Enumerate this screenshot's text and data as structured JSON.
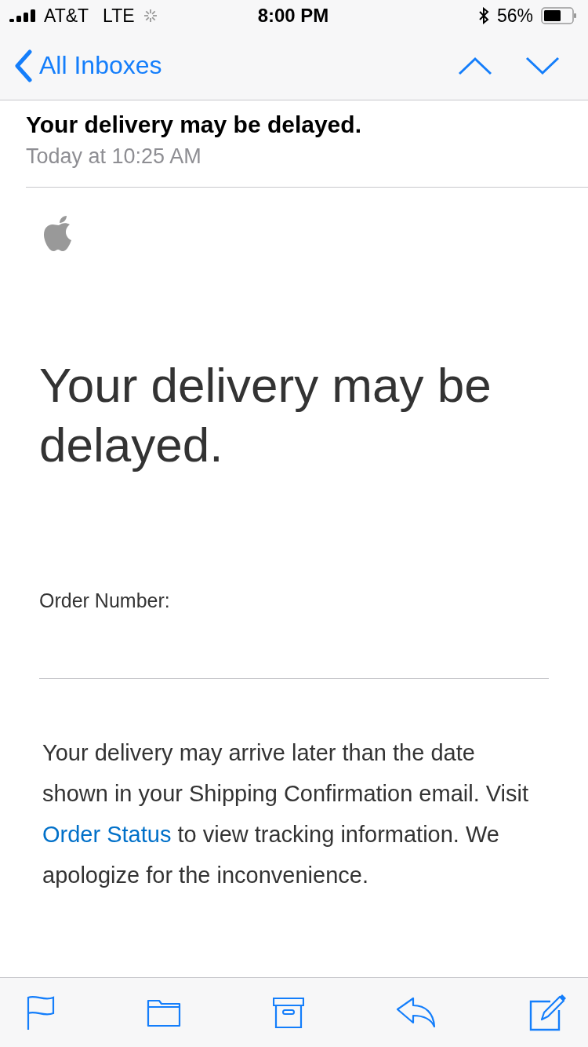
{
  "status_bar": {
    "carrier": "AT&T",
    "network": "LTE",
    "time": "8:00 PM",
    "battery": "56%"
  },
  "nav": {
    "back": "All Inboxes"
  },
  "message": {
    "subject": "Your delivery may be delayed.",
    "date": "Today at 10:25 AM"
  },
  "email_body": {
    "headline": "Your delivery may be delayed.",
    "order_label": "Order Number:",
    "paragraph": {
      "before": "Your delivery may arrive later than the date shown in your Shipping Confirmation email. Visit ",
      "link": "Order Status",
      "after": " to view tracking information. We apologize for the inconvenience."
    }
  }
}
